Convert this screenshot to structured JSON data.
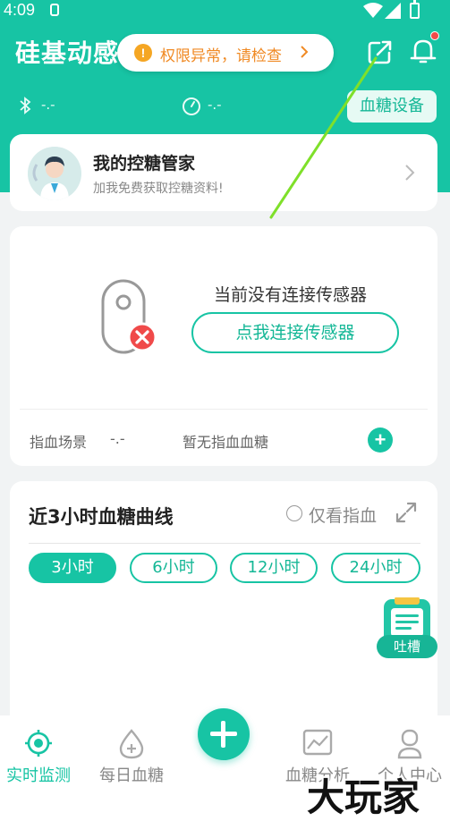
{
  "statusbar": {
    "time": "4:09"
  },
  "header": {
    "title": "硅基动感",
    "alert_text": "权限异常，请检查",
    "alert_icon": "!",
    "bluetooth_value": "-.-",
    "timer_value": "-.-",
    "device_button": "血糖设备"
  },
  "manager_card": {
    "title": "我的控糖管家",
    "subtitle": "加我免费获取控糖资料!"
  },
  "sensor_card": {
    "message": "当前没有连接传感器",
    "connect_button": "点我连接传感器",
    "finger_label": "指血场景",
    "finger_value": "-.-",
    "finger_empty": "暂无指血血糖",
    "add_symbol": "+"
  },
  "curve_card": {
    "title": "近3小时血糖曲线",
    "only_finger_label": "仅看指血",
    "tabs": [
      {
        "label": "3小时",
        "active": true
      },
      {
        "label": "6小时",
        "active": false
      },
      {
        "label": "12小时",
        "active": false
      },
      {
        "label": "24小时",
        "active": false
      }
    ]
  },
  "feedback": {
    "label": "吐槽"
  },
  "bottom_nav": {
    "items": [
      {
        "label": "实时监测",
        "icon": "crosshair-icon",
        "active": true
      },
      {
        "label": "每日血糖",
        "icon": "blood-drop-icon",
        "active": false
      },
      {
        "label": "血糖分析",
        "icon": "chart-icon",
        "active": false
      },
      {
        "label": "个人中心",
        "icon": "person-icon",
        "active": false
      }
    ]
  },
  "watermark": "大玩家",
  "colors": {
    "brand": "#17c4a4",
    "warning": "#f08a24",
    "danger": "#f04a4a",
    "background": "#f1f3f4"
  }
}
